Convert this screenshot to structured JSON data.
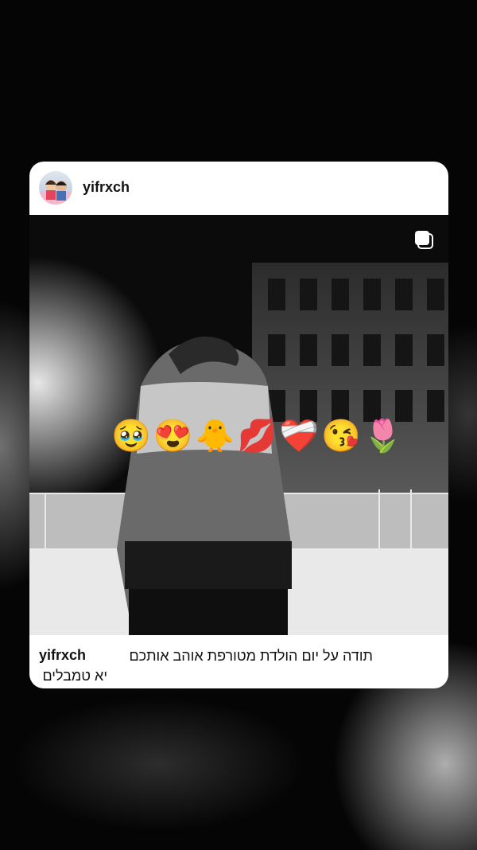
{
  "post": {
    "username": "yifrxch",
    "caption_user": "yifrxch",
    "caption_line1": "תודה על יום הולדת מטורפת אוהב אותכם",
    "caption_line2": "יא טמבלים",
    "media_type_icon": "multiple-posts-icon",
    "sticker_emojis": [
      "🥹",
      "😍",
      "🐥",
      "💋",
      "❤️‍🩹",
      "😘",
      "🌷"
    ]
  }
}
